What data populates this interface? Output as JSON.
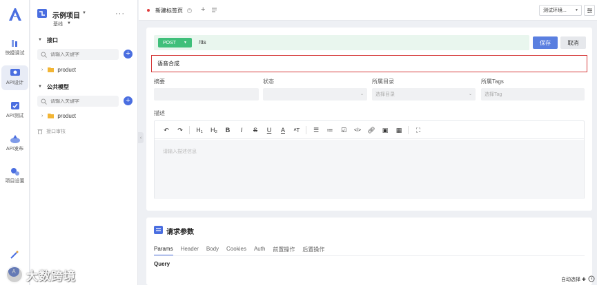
{
  "colors": {
    "accent": "#4a6ee0",
    "method": "#3fbf7a",
    "save": "#5a7fe0",
    "highlight_border": "#d63a3a"
  },
  "rail": {
    "items": [
      {
        "label": "快捷调试",
        "icon": "quick-debug-icon"
      },
      {
        "label": "API设计",
        "icon": "api-design-icon",
        "active": true
      },
      {
        "label": "API测试",
        "icon": "api-test-icon"
      },
      {
        "label": "API发布",
        "icon": "api-publish-icon"
      },
      {
        "label": "项目设置",
        "icon": "project-settings-icon"
      }
    ]
  },
  "tree": {
    "project_name": "示例项目",
    "branch": "基线",
    "sections": [
      {
        "title": "接口",
        "search_placeholder": "请输入关键字",
        "folder": "product"
      },
      {
        "title": "公共模型",
        "search_placeholder": "请输入关键字",
        "folder": "product"
      }
    ],
    "recycle_label": "接口审核"
  },
  "topbar": {
    "tab_label": "新建标签页",
    "env_label": "测试环境..."
  },
  "request": {
    "method": "POST",
    "url": "/tts",
    "save_label": "保存",
    "cancel_label": "取消",
    "name_value": "语音合成"
  },
  "fields": {
    "summary_label": "摘要",
    "status_label": "状态",
    "catalog_label": "所属目录",
    "catalog_placeholder": "选择目录",
    "tags_label": "所属Tags",
    "tags_placeholder": "选择Tag",
    "desc_label": "描述",
    "desc_placeholder": "请输入描述信息"
  },
  "params": {
    "title": "请求参数",
    "tabs": [
      "Params",
      "Header",
      "Body",
      "Cookies",
      "Auth",
      "前置操作",
      "后置操作"
    ],
    "query_label": "Query"
  },
  "footer": {
    "auto_label": "自动选择"
  },
  "watermark": {
    "text": "大数跨境"
  }
}
